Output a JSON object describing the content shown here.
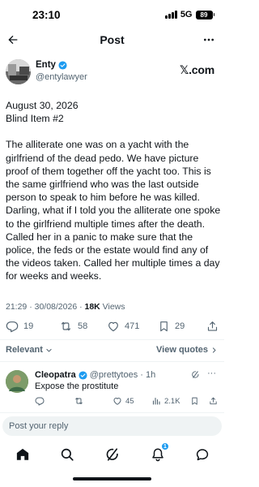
{
  "status": {
    "time": "23:10",
    "network": "5G",
    "battery": "89"
  },
  "header": {
    "title": "Post",
    "back": "arrow-left-icon",
    "more": "more-horizontal-icon"
  },
  "post": {
    "author_name": "Enty",
    "author_handle": "@entylawyer",
    "watermark": "𝕏.com",
    "date_line": "August 30, 2026",
    "blind_item_line": "Blind Item #2",
    "body": "The alliterate one was on a yacht with the girlfriend of the dead pedo. We have picture proof of them together off the yacht too. This is the same girlfriend who was the last outside person to speak to him before he was killed. Darling, what if I told you the alliterate one spoke to the girlfriend multiple times after the death. Called her in a panic to make sure that the police, the feds or the estate would find any of the videos taken. Called her multiple times a day for weeks and weeks.",
    "timestamp": "21:29 · 30/08/2026 · ",
    "views_count": "18K",
    "views_label": " Views",
    "replies": "19",
    "reposts": "58",
    "likes": "471",
    "bookmarks": "29"
  },
  "filters": {
    "sort_label": "Relevant",
    "view_quotes_label": "View quotes"
  },
  "reply": {
    "name": "Cleopatra",
    "handle": "@prettytoes · 1h",
    "text": "Expose the prostitute",
    "more": "···",
    "likes": "45",
    "views": "2.1K"
  },
  "composer": {
    "placeholder": "Post your reply"
  },
  "nav": {
    "notifications_badge": "1"
  },
  "colors": {
    "accent": "#1d9bf0",
    "text": "#0f1419",
    "muted": "#536471",
    "divider": "#eff3f4"
  }
}
